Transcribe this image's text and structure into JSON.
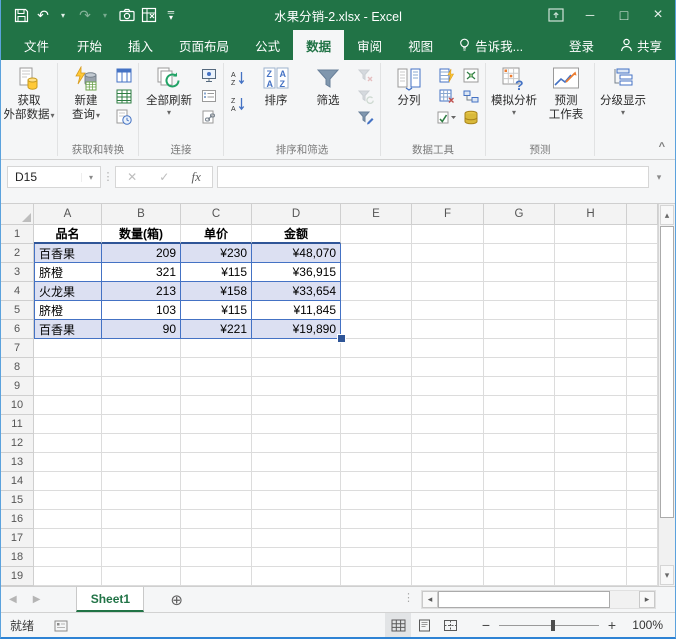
{
  "window": {
    "title": "水果分销-2.xlsx - Excel"
  },
  "colors": {
    "excel_green": "#217346",
    "table_border_blue": "#4472c4",
    "table_header_border": "#2f5597",
    "banded_row_fill": "#dce0f2",
    "window_border_blue": "#2e83d4"
  },
  "tabs": {
    "file": "文件",
    "items": [
      "开始",
      "插入",
      "页面布局",
      "公式",
      "数据",
      "审阅",
      "视图"
    ],
    "active": "数据",
    "tell_me": "告诉我...",
    "sign_in": "登录",
    "share": "共享"
  },
  "ribbon": {
    "get_external_line1": "获取",
    "get_external_line2": "外部数据",
    "new_query_line1": "新建",
    "new_query_line2": "查询",
    "refresh_all": "全部刷新",
    "sort": "排序",
    "filter": "筛选",
    "text_to_columns": "分列",
    "what_if": "模拟分析",
    "forecast_line1": "预测",
    "forecast_line2": "工作表",
    "outline": "分级显示",
    "group_get_transform": "获取和转换",
    "group_connections": "连接",
    "group_sort_filter": "排序和筛选",
    "group_data_tools": "数据工具",
    "group_forecast": "预测"
  },
  "formula_bar": {
    "name_box": "D15",
    "fx_label": "fx"
  },
  "sheet": {
    "columns": [
      "A",
      "B",
      "C",
      "D",
      "E",
      "F",
      "G",
      "H"
    ],
    "row_count": 19,
    "table": {
      "headers": [
        "品名",
        "数量(箱)",
        "单价",
        "金额"
      ],
      "rows": [
        [
          "百香果",
          "209",
          "¥230",
          "¥48,070"
        ],
        [
          "脐橙",
          "321",
          "¥115",
          "¥36,915"
        ],
        [
          "火龙果",
          "213",
          "¥158",
          "¥33,654"
        ],
        [
          "脐橙",
          "103",
          "¥115",
          "¥11,845"
        ],
        [
          "百香果",
          "90",
          "¥221",
          "¥19,890"
        ]
      ]
    }
  },
  "sheet_bar": {
    "active_sheet": "Sheet1"
  },
  "status_bar": {
    "ready": "就绪",
    "zoom": "100%"
  },
  "glyphs": {
    "undo": "↶",
    "redo": "↷",
    "dropdown": "▾",
    "up": "▴",
    "down": "▾",
    "left_small": "◂",
    "right_small": "▸",
    "nav_left": "◀",
    "nav_right": "▶",
    "minimize": "─",
    "maximize": "□",
    "close": "×",
    "cancel": "✕",
    "enter": "✓",
    "dots": "⋮",
    "add_sheet": "⊕",
    "collapse": "^",
    "minus": "−",
    "plus": "+",
    "sort_az_a": "A",
    "sort_az_z": "Z",
    "arrow_down": "↓"
  }
}
